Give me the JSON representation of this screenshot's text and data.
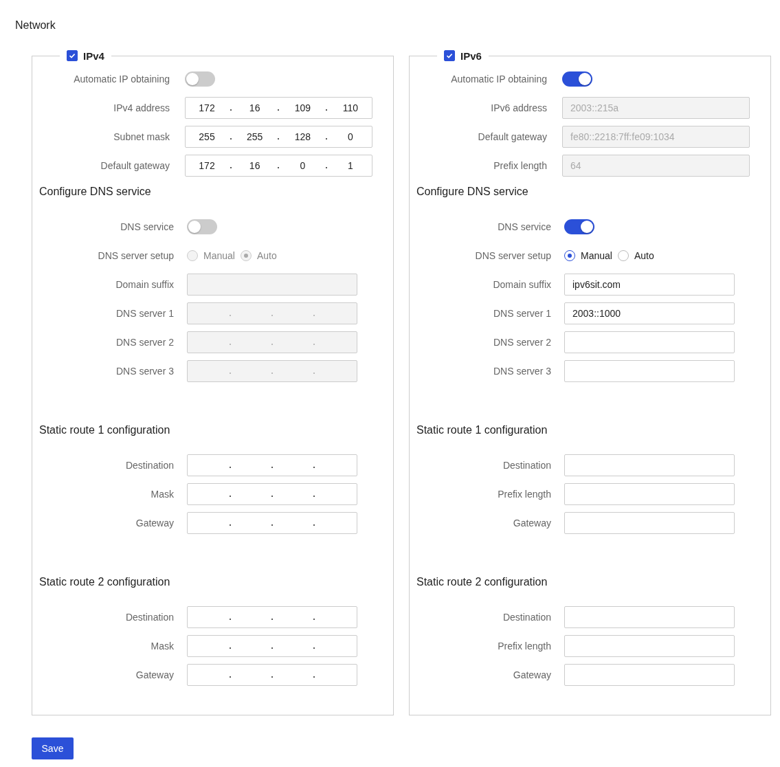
{
  "page": {
    "title": "Network"
  },
  "panels": [
    {
      "label": "IPv4",
      "checked": true,
      "auto_ip": {
        "label": "Automatic IP obtaining",
        "on": false
      },
      "fields": [
        {
          "label": "IPv4 address",
          "kind": "ip",
          "octets": [
            "172",
            "16",
            "109",
            "110"
          ],
          "disabled": false
        },
        {
          "label": "Subnet mask",
          "kind": "ip",
          "octets": [
            "255",
            "255",
            "128",
            "0"
          ],
          "disabled": false
        },
        {
          "label": "Default gateway",
          "kind": "ip",
          "octets": [
            "172",
            "16",
            "0",
            "1"
          ],
          "disabled": false
        }
      ],
      "dns": {
        "heading": "Configure DNS service",
        "service": {
          "label": "DNS service",
          "on": false
        },
        "setup": {
          "label": "DNS server setup",
          "disabled": true,
          "options": [
            {
              "label": "Manual",
              "selected": false
            },
            {
              "label": "Auto",
              "selected": true
            }
          ]
        },
        "fields": [
          {
            "label": "Domain suffix",
            "kind": "text",
            "disabled": true
          },
          {
            "label": "DNS server 1",
            "kind": "ip",
            "disabled": true
          },
          {
            "label": "DNS server 2",
            "kind": "ip",
            "disabled": true
          },
          {
            "label": "DNS server 3",
            "kind": "ip",
            "disabled": true
          }
        ]
      },
      "routes": [
        {
          "heading": "Static route 1 configuration",
          "fields": [
            {
              "label": "Destination",
              "kind": "ip",
              "disabled": false
            },
            {
              "label": "Mask",
              "kind": "ip",
              "disabled": false
            },
            {
              "label": "Gateway",
              "kind": "ip",
              "disabled": false
            }
          ]
        },
        {
          "heading": "Static route 2 configuration",
          "fields": [
            {
              "label": "Destination",
              "kind": "ip",
              "disabled": false
            },
            {
              "label": "Mask",
              "kind": "ip",
              "disabled": false
            },
            {
              "label": "Gateway",
              "kind": "ip",
              "disabled": false
            }
          ]
        }
      ]
    },
    {
      "label": "IPv6",
      "checked": true,
      "auto_ip": {
        "label": "Automatic IP obtaining",
        "on": true
      },
      "fields": [
        {
          "label": "IPv6 address",
          "kind": "text",
          "value": "2003::215a",
          "disabled": true
        },
        {
          "label": "Default gateway",
          "kind": "text",
          "value": "fe80::2218:7ff:fe09:1034",
          "disabled": true
        },
        {
          "label": "Prefix length",
          "kind": "text",
          "value": "64",
          "disabled": true
        }
      ],
      "dns": {
        "heading": "Configure DNS service",
        "service": {
          "label": "DNS service",
          "on": true
        },
        "setup": {
          "label": "DNS server setup",
          "disabled": false,
          "options": [
            {
              "label": "Manual",
              "selected": true
            },
            {
              "label": "Auto",
              "selected": false
            }
          ]
        },
        "fields": [
          {
            "label": "Domain suffix",
            "kind": "text",
            "value": "ipv6sit.com",
            "disabled": false
          },
          {
            "label": "DNS server 1",
            "kind": "text",
            "value": "2003::1000",
            "disabled": false
          },
          {
            "label": "DNS server 2",
            "kind": "text",
            "disabled": false
          },
          {
            "label": "DNS server 3",
            "kind": "text",
            "disabled": false
          }
        ]
      },
      "routes": [
        {
          "heading": "Static route 1 configuration",
          "fields": [
            {
              "label": "Destination",
              "kind": "text",
              "disabled": false
            },
            {
              "label": "Prefix length",
              "kind": "text",
              "disabled": false
            },
            {
              "label": "Gateway",
              "kind": "text",
              "disabled": false
            }
          ]
        },
        {
          "heading": "Static route 2 configuration",
          "fields": [
            {
              "label": "Destination",
              "kind": "text",
              "disabled": false
            },
            {
              "label": "Prefix length",
              "kind": "text",
              "disabled": false
            },
            {
              "label": "Gateway",
              "kind": "text",
              "disabled": false
            }
          ]
        }
      ]
    }
  ],
  "save_button": {
    "label": "Save"
  }
}
